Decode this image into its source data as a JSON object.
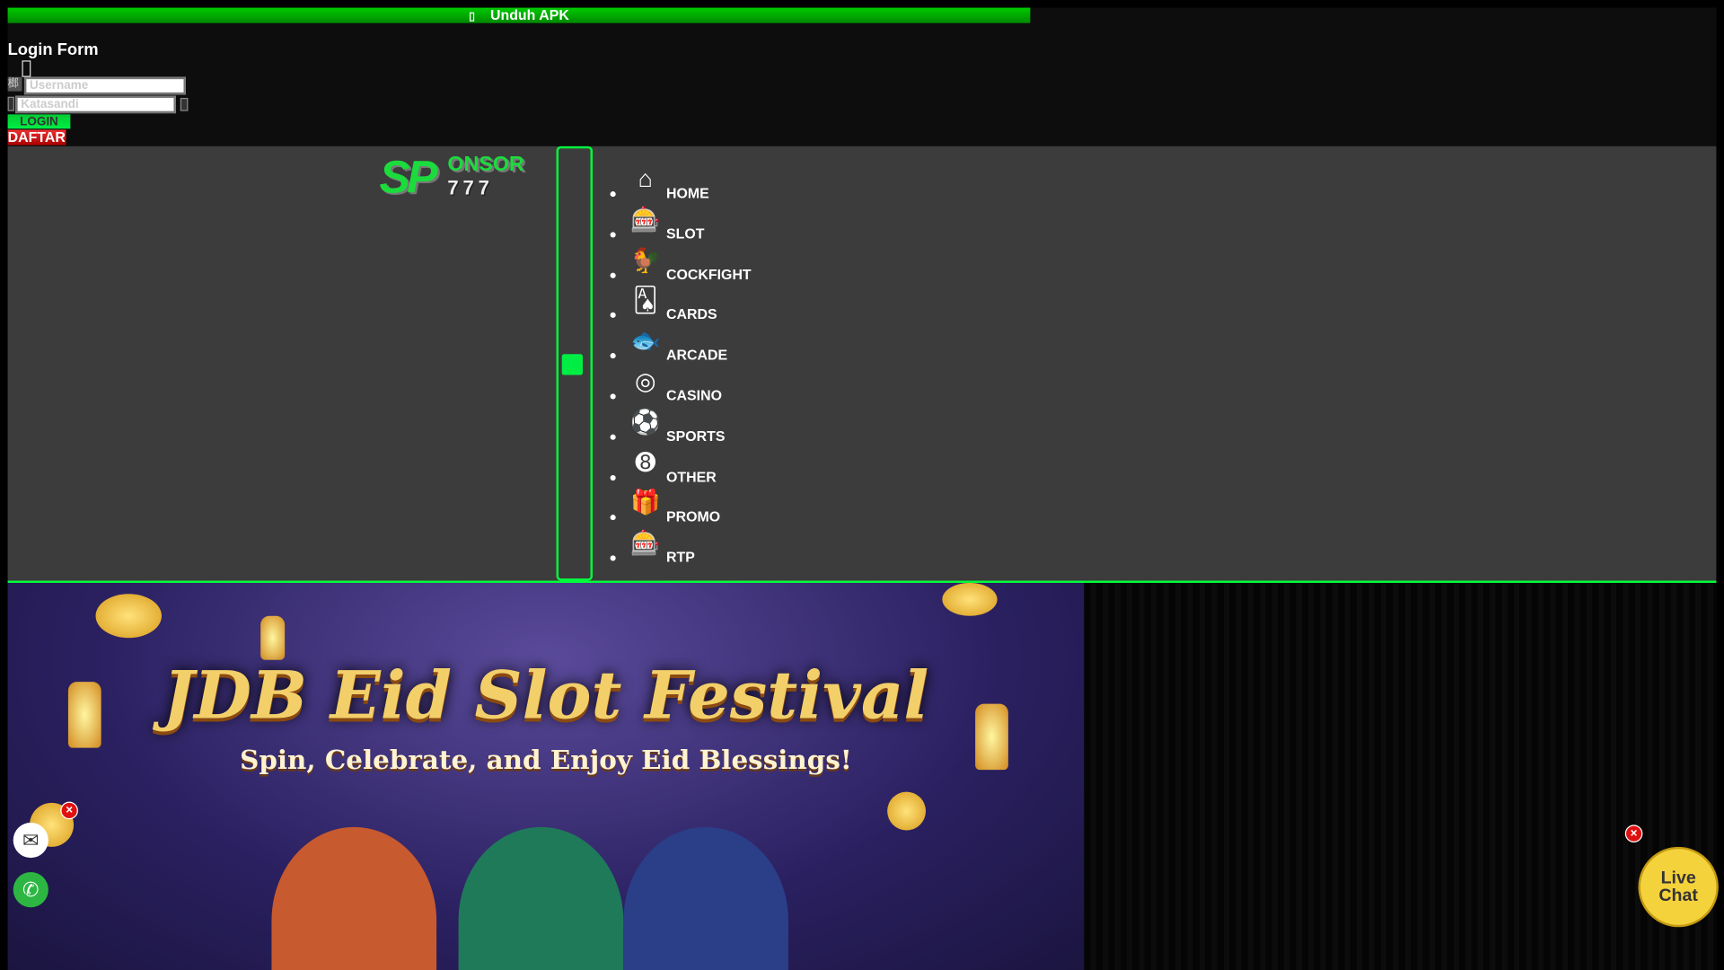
{
  "top_bar": {
    "apk_icon": "android-icon",
    "apk_label": "Unduh APK"
  },
  "login": {
    "title": "Login Form",
    "username_placeholder": "Username",
    "password_placeholder": "Katasandi",
    "login_label": "LOGIN",
    "register_label": "DAFTAR"
  },
  "logo": {
    "text": "SP",
    "text2": "ONSOR",
    "text3": "777"
  },
  "menu": [
    {
      "label": "HOME",
      "icon": "home-icon",
      "glyph": "⌂"
    },
    {
      "label": "SLOT",
      "icon": "slot-machine-icon",
      "glyph": "🎰"
    },
    {
      "label": "COCKFIGHT",
      "icon": "rooster-icon",
      "glyph": "🐓"
    },
    {
      "label": "CARDS",
      "icon": "cards-icon",
      "glyph": "🂡"
    },
    {
      "label": "ARCADE",
      "icon": "fish-icon",
      "glyph": "🐟"
    },
    {
      "label": "CASINO",
      "icon": "roulette-icon",
      "glyph": "◎"
    },
    {
      "label": "SPORTS",
      "icon": "soccer-player-icon",
      "glyph": "⚽"
    },
    {
      "label": "OTHER",
      "icon": "lottery-balls-icon",
      "glyph": "➑"
    },
    {
      "label": "PROMO",
      "icon": "gift-icon",
      "glyph": "🎁"
    },
    {
      "label": "RTP",
      "icon": "slot-machine-icon",
      "glyph": "🎰"
    }
  ],
  "banner": {
    "title": "JDB Eid Slot Festival",
    "subtitle": "Spin, Celebrate, and Enjoy Eid Blessings!"
  },
  "widgets": {
    "close": "×",
    "live_chat": "Live Chat",
    "live1": "Live",
    "live2": "Chat"
  },
  "colors": {
    "accent": "#00ff3c",
    "nav_bg": "#3c3c3c",
    "register": "#cc1111"
  }
}
